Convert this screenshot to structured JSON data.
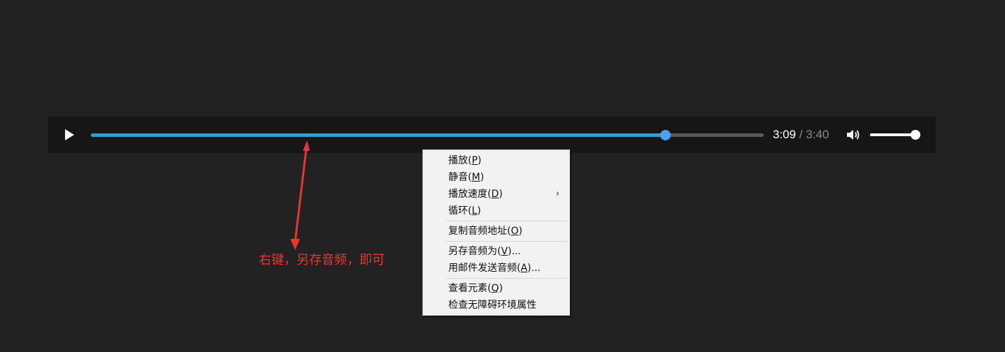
{
  "player": {
    "progress_fraction": 0.853,
    "current_time": "3:09",
    "separator": "/",
    "duration": "3:40",
    "volume_fraction": 1.0,
    "colors": {
      "progress": "#1ea7e8",
      "thumb": "#4aa3f0",
      "track": "#5a5a5a",
      "background": "#161616"
    }
  },
  "context_menu": {
    "items": [
      {
        "pre": "播放(",
        "key": "P",
        "post": ")"
      },
      {
        "pre": "静音(",
        "key": "M",
        "post": ")"
      },
      {
        "pre": "播放速度(",
        "key": "D",
        "post": ")",
        "submenu_arrow": "›"
      },
      {
        "pre": "循环(",
        "key": "L",
        "post": ")"
      },
      {
        "pre": "复制音频地址(",
        "key": "O",
        "post": ")"
      },
      {
        "pre": "另存音频为(",
        "key": "V",
        "post": ")..."
      },
      {
        "pre": "用邮件发送音频(",
        "key": "A",
        "post": ")..."
      },
      {
        "pre": "查看元素(",
        "key": "Q",
        "post": ")"
      },
      {
        "pre": "检查无障碍环境属性",
        "key": "",
        "post": ""
      }
    ]
  },
  "annotation": {
    "text": "右键，另存音频，即可",
    "color": "#e83535"
  }
}
